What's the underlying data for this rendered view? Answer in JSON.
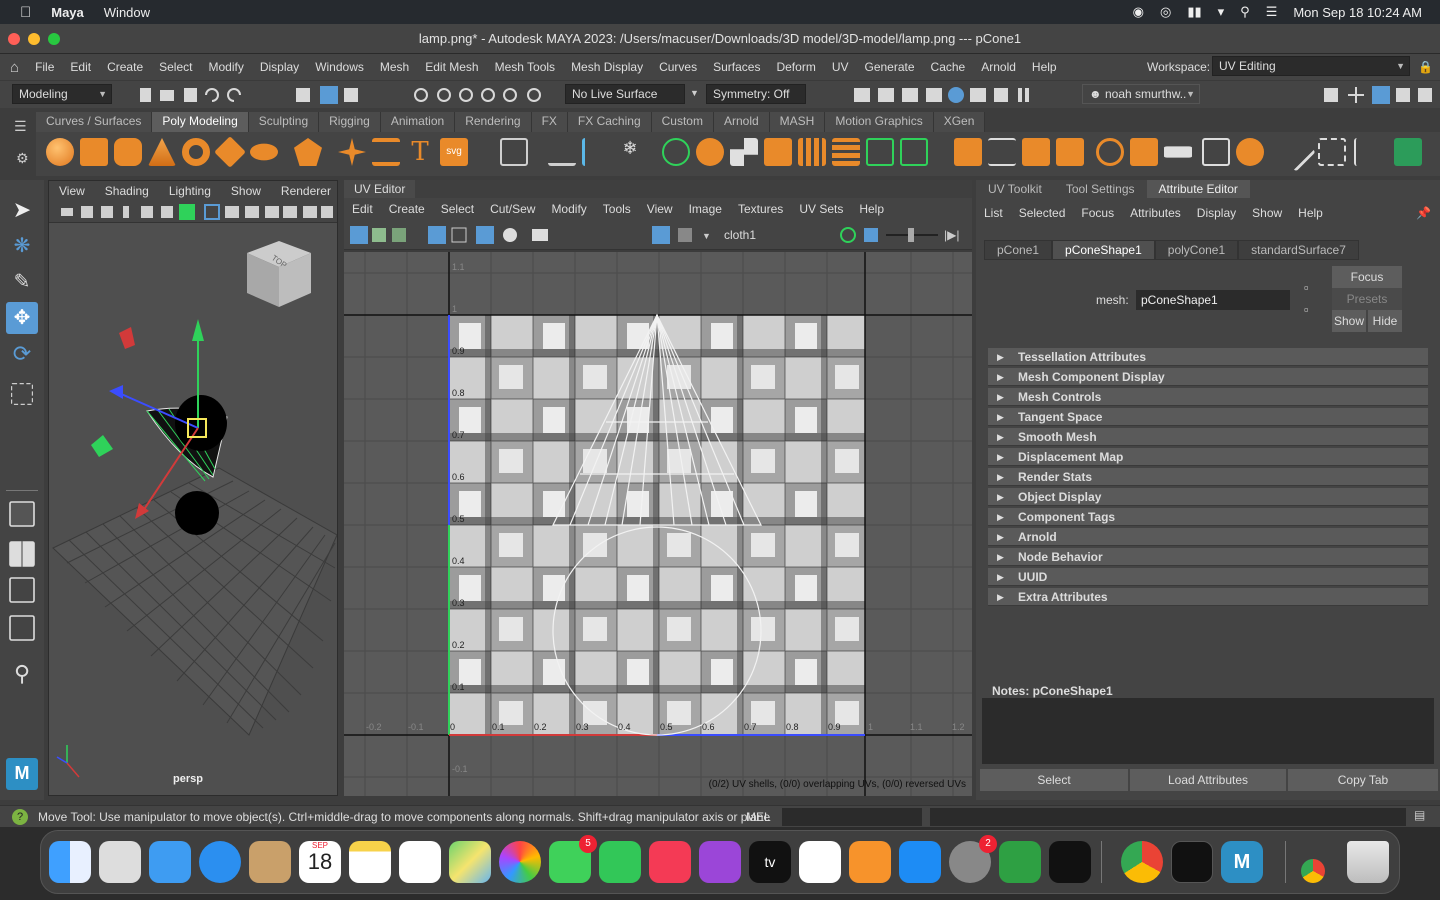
{
  "mac_menubar": {
    "app": "Maya",
    "menu_window": "Window",
    "datetime": "Mon Sep 18  10:24 AM"
  },
  "window": {
    "title": "lamp.png* - Autodesk MAYA 2023: /Users/macuser/Downloads/3D model/3D-model/lamp.png   ---   pCone1"
  },
  "main_menu": [
    "File",
    "Edit",
    "Create",
    "Select",
    "Modify",
    "Display",
    "Windows",
    "Mesh",
    "Edit Mesh",
    "Mesh Tools",
    "Mesh Display",
    "Curves",
    "Surfaces",
    "Deform",
    "UV",
    "Generate",
    "Cache",
    "Arnold",
    "Help"
  ],
  "workspace": {
    "label": "Workspace:",
    "value": "UV Editing"
  },
  "status_line": {
    "menu_set": "Modeling",
    "live_surface": "No Live Surface",
    "symmetry": "Symmetry: Off",
    "user": "noah smurthw.."
  },
  "shelf_tabs": [
    "Curves / Surfaces",
    "Poly Modeling",
    "Sculpting",
    "Rigging",
    "Animation",
    "Rendering",
    "FX",
    "FX Caching",
    "Custom",
    "Arnold",
    "MASH",
    "Motion Graphics",
    "XGen"
  ],
  "shelf_active": "Poly Modeling",
  "viewport": {
    "menu": [
      "View",
      "Shading",
      "Lighting",
      "Show",
      "Renderer"
    ],
    "camera": "persp",
    "cube_label": "TOP"
  },
  "uv_editor": {
    "tab": "UV Editor",
    "menu": [
      "Edit",
      "Create",
      "Select",
      "Cut/Sew",
      "Modify",
      "Tools",
      "View",
      "Image",
      "Textures",
      "UV Sets",
      "Help"
    ],
    "texture": "cloth1",
    "status": "(0/2) UV shells, (0/0) overlapping UVs, (0/0) reversed UVs",
    "v_ticks": [
      "1.1",
      "1",
      "0.9",
      "0.8",
      "0.7",
      "0.6",
      "0.5",
      "0.4",
      "0.3",
      "0.2",
      "0.1",
      "-0.1"
    ],
    "u_ticks": [
      "-0.2",
      "-0.1",
      "0",
      "0.1",
      "0.2",
      "0.3",
      "0.4",
      "0.5",
      "0.6",
      "0.7",
      "0.8",
      "0.9",
      "1",
      "1.1",
      "1.2"
    ]
  },
  "attribute_editor": {
    "tabs": [
      "UV Toolkit",
      "Tool Settings",
      "Attribute Editor"
    ],
    "active_tab": "Attribute Editor",
    "menu": [
      "List",
      "Selected",
      "Focus",
      "Attributes",
      "Display",
      "Show",
      "Help"
    ],
    "node_tabs": [
      "pCone1",
      "pConeShape1",
      "polyCone1",
      "standardSurface7"
    ],
    "active_node": "pConeShape1",
    "mesh_label": "mesh:",
    "mesh_value": "pConeShape1",
    "focus": "Focus",
    "presets": "Presets",
    "show": "Show",
    "hide": "Hide",
    "sections": [
      "Tessellation Attributes",
      "Mesh Component Display",
      "Mesh Controls",
      "Tangent Space",
      "Smooth Mesh",
      "Displacement Map",
      "Render Stats",
      "Object Display",
      "Component Tags",
      "Arnold",
      "Node Behavior",
      "UUID",
      "Extra Attributes"
    ],
    "notes": "Notes:  pConeShape1",
    "buttons": {
      "select": "Select",
      "load": "Load Attributes",
      "copy": "Copy Tab"
    }
  },
  "help_line": {
    "text": "Move Tool: Use manipulator to move object(s). Ctrl+middle-drag to move components along normals. Shift+drag manipulator axis or plane",
    "mel": "MEL"
  },
  "dock": {
    "calendar_month": "SEP",
    "calendar_day": "18",
    "messages_badge": "5",
    "settings_badge": "2",
    "tv_label": "tv",
    "maya_label": "M"
  },
  "colors": {
    "accent_blue": "#5a9bd5",
    "uv_green": "#2fd25a",
    "uv_blue": "#3b4dff"
  }
}
